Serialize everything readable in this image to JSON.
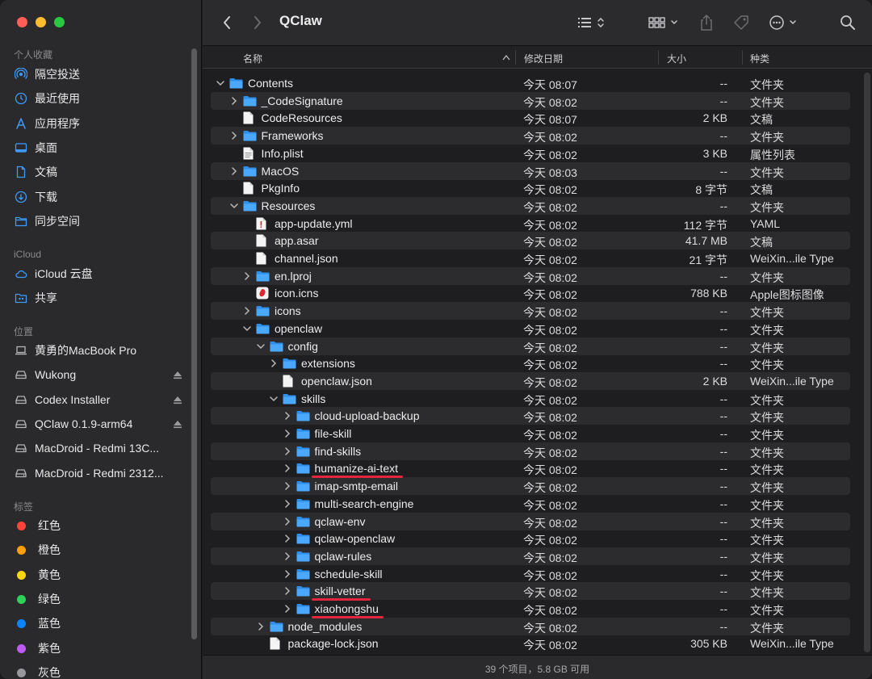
{
  "window": {
    "title": "QClaw",
    "status": "39 个项目，5.8 GB 可用"
  },
  "sidebar": {
    "favorites": {
      "heading": "个人收藏",
      "items": [
        {
          "label": "隔空投送",
          "icon": "airdrop-icon"
        },
        {
          "label": "最近使用",
          "icon": "clock-icon"
        },
        {
          "label": "应用程序",
          "icon": "applications-icon"
        },
        {
          "label": "桌面",
          "icon": "desktop-icon"
        },
        {
          "label": "文稿",
          "icon": "document-icon"
        },
        {
          "label": "下载",
          "icon": "download-icon"
        },
        {
          "label": "同步空间",
          "icon": "folder-icon"
        }
      ]
    },
    "icloud": {
      "heading": "iCloud",
      "items": [
        {
          "label": "iCloud 云盘",
          "icon": "cloud-icon"
        },
        {
          "label": "共享",
          "icon": "shared-folder-icon"
        }
      ]
    },
    "locations": {
      "heading": "位置",
      "items": [
        {
          "label": "黄勇的MacBook Pro",
          "icon": "laptop-icon",
          "eject": false
        },
        {
          "label": "Wukong",
          "icon": "drive-icon",
          "eject": true
        },
        {
          "label": "Codex Installer",
          "icon": "drive-icon",
          "eject": true
        },
        {
          "label": "QClaw 0.1.9-arm64",
          "icon": "drive-icon",
          "eject": true
        },
        {
          "label": "MacDroid - Redmi 13C...",
          "icon": "network-drive-icon",
          "eject": false
        },
        {
          "label": "MacDroid - Redmi 2312...",
          "icon": "network-drive-icon",
          "eject": false
        }
      ]
    },
    "tags": {
      "heading": "标签",
      "items": [
        {
          "label": "红色",
          "color": "#ff453a"
        },
        {
          "label": "橙色",
          "color": "#ff9f0a"
        },
        {
          "label": "黄色",
          "color": "#ffd60a"
        },
        {
          "label": "绿色",
          "color": "#30d158"
        },
        {
          "label": "蓝色",
          "color": "#0a84ff"
        },
        {
          "label": "紫色",
          "color": "#bf5af2"
        },
        {
          "label": "灰色",
          "color": "#98989d"
        }
      ]
    }
  },
  "columns": {
    "name": "名称",
    "date": "修改日期",
    "size": "大小",
    "kind": "种类"
  },
  "files": [
    {
      "name": "Contents",
      "type": "folder",
      "depth": 0,
      "expanded": true,
      "date": "今天 08:07",
      "size": "--",
      "kind": "文件夹"
    },
    {
      "name": "_CodeSignature",
      "type": "folder",
      "depth": 1,
      "expanded": false,
      "date": "今天 08:02",
      "size": "--",
      "kind": "文件夹"
    },
    {
      "name": "CodeResources",
      "type": "file",
      "depth": 1,
      "date": "今天 08:07",
      "size": "2 KB",
      "kind": "文稿"
    },
    {
      "name": "Frameworks",
      "type": "folder",
      "depth": 1,
      "expanded": false,
      "date": "今天 08:02",
      "size": "--",
      "kind": "文件夹"
    },
    {
      "name": "Info.plist",
      "type": "plist",
      "depth": 1,
      "date": "今天 08:02",
      "size": "3 KB",
      "kind": "属性列表"
    },
    {
      "name": "MacOS",
      "type": "folder",
      "depth": 1,
      "expanded": false,
      "date": "今天 08:03",
      "size": "--",
      "kind": "文件夹"
    },
    {
      "name": "PkgInfo",
      "type": "file",
      "depth": 1,
      "date": "今天 08:02",
      "size": "8 字节",
      "kind": "文稿"
    },
    {
      "name": "Resources",
      "type": "folder",
      "depth": 1,
      "expanded": true,
      "date": "今天 08:02",
      "size": "--",
      "kind": "文件夹"
    },
    {
      "name": "app-update.yml",
      "type": "yml",
      "depth": 2,
      "date": "今天 08:02",
      "size": "112 字节",
      "kind": "YAML"
    },
    {
      "name": "app.asar",
      "type": "file",
      "depth": 2,
      "date": "今天 08:02",
      "size": "41.7 MB",
      "kind": "文稿"
    },
    {
      "name": "channel.json",
      "type": "file",
      "depth": 2,
      "date": "今天 08:02",
      "size": "21 字节",
      "kind": "WeiXin...ile Type"
    },
    {
      "name": "en.lproj",
      "type": "folder",
      "depth": 2,
      "expanded": false,
      "date": "今天 08:02",
      "size": "--",
      "kind": "文件夹"
    },
    {
      "name": "icon.icns",
      "type": "icns",
      "depth": 2,
      "date": "今天 08:02",
      "size": "788 KB",
      "kind": "Apple图标图像"
    },
    {
      "name": "icons",
      "type": "folder",
      "depth": 2,
      "expanded": false,
      "date": "今天 08:02",
      "size": "--",
      "kind": "文件夹"
    },
    {
      "name": "openclaw",
      "type": "folder",
      "depth": 2,
      "expanded": true,
      "date": "今天 08:02",
      "size": "--",
      "kind": "文件夹"
    },
    {
      "name": "config",
      "type": "folder",
      "depth": 3,
      "expanded": true,
      "date": "今天 08:02",
      "size": "--",
      "kind": "文件夹"
    },
    {
      "name": "extensions",
      "type": "folder",
      "depth": 4,
      "expanded": false,
      "date": "今天 08:02",
      "size": "--",
      "kind": "文件夹"
    },
    {
      "name": "openclaw.json",
      "type": "file",
      "depth": 4,
      "date": "今天 08:02",
      "size": "2 KB",
      "kind": "WeiXin...ile Type"
    },
    {
      "name": "skills",
      "type": "folder",
      "depth": 4,
      "expanded": true,
      "date": "今天 08:02",
      "size": "--",
      "kind": "文件夹"
    },
    {
      "name": "cloud-upload-backup",
      "type": "folder",
      "depth": 5,
      "expanded": false,
      "date": "今天 08:02",
      "size": "--",
      "kind": "文件夹"
    },
    {
      "name": "file-skill",
      "type": "folder",
      "depth": 5,
      "expanded": false,
      "date": "今天 08:02",
      "size": "--",
      "kind": "文件夹"
    },
    {
      "name": "find-skills",
      "type": "folder",
      "depth": 5,
      "expanded": false,
      "date": "今天 08:02",
      "size": "--",
      "kind": "文件夹"
    },
    {
      "name": "humanize-ai-text",
      "type": "folder",
      "depth": 5,
      "expanded": false,
      "date": "今天 08:02",
      "size": "--",
      "kind": "文件夹",
      "highlight": true
    },
    {
      "name": "imap-smtp-email",
      "type": "folder",
      "depth": 5,
      "expanded": false,
      "date": "今天 08:02",
      "size": "--",
      "kind": "文件夹"
    },
    {
      "name": "multi-search-engine",
      "type": "folder",
      "depth": 5,
      "expanded": false,
      "date": "今天 08:02",
      "size": "--",
      "kind": "文件夹"
    },
    {
      "name": "qclaw-env",
      "type": "folder",
      "depth": 5,
      "expanded": false,
      "date": "今天 08:02",
      "size": "--",
      "kind": "文件夹"
    },
    {
      "name": "qclaw-openclaw",
      "type": "folder",
      "depth": 5,
      "expanded": false,
      "date": "今天 08:02",
      "size": "--",
      "kind": "文件夹"
    },
    {
      "name": "qclaw-rules",
      "type": "folder",
      "depth": 5,
      "expanded": false,
      "date": "今天 08:02",
      "size": "--",
      "kind": "文件夹"
    },
    {
      "name": "schedule-skill",
      "type": "folder",
      "depth": 5,
      "expanded": false,
      "date": "今天 08:02",
      "size": "--",
      "kind": "文件夹"
    },
    {
      "name": "skill-vetter",
      "type": "folder",
      "depth": 5,
      "expanded": false,
      "date": "今天 08:02",
      "size": "--",
      "kind": "文件夹",
      "highlight": true
    },
    {
      "name": "xiaohongshu",
      "type": "folder",
      "depth": 5,
      "expanded": false,
      "date": "今天 08:02",
      "size": "--",
      "kind": "文件夹",
      "highlight": true
    },
    {
      "name": "node_modules",
      "type": "folder",
      "depth": 3,
      "expanded": false,
      "date": "今天 08:02",
      "size": "--",
      "kind": "文件夹"
    },
    {
      "name": "package-lock.json",
      "type": "file",
      "depth": 3,
      "date": "今天 08:02",
      "size": "305 KB",
      "kind": "WeiXin...ile Type"
    }
  ],
  "colors": {
    "accent": "#3d9bff",
    "folder": "#4aa8ff",
    "annotation": "#e3263c"
  }
}
